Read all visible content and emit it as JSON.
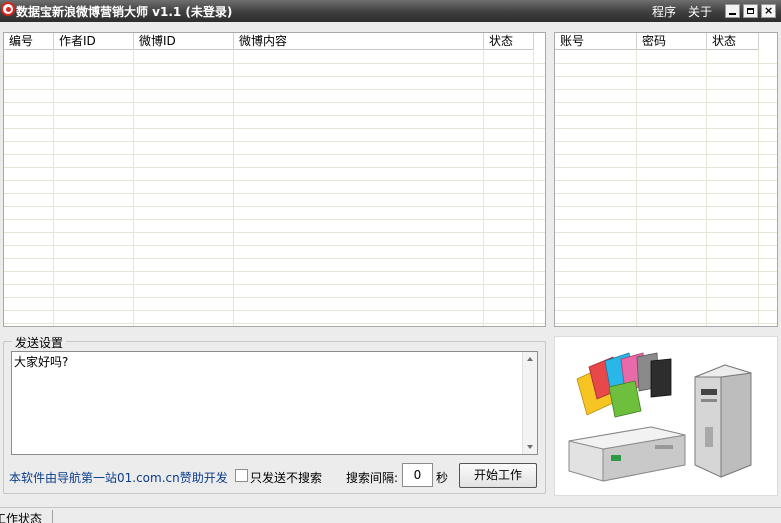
{
  "window": {
    "title": "数据宝新浪微博营销大师 v1.1 (未登录)",
    "menu": [
      "程序",
      "关于"
    ],
    "controls": {
      "minimize": "",
      "maximize": "",
      "close": "×"
    }
  },
  "posts_table": {
    "columns": [
      "编号",
      "作者ID",
      "微博ID",
      "微博内容",
      "状态"
    ],
    "rows": []
  },
  "accounts_table": {
    "columns": [
      "账号",
      "密码",
      "状态"
    ],
    "rows": []
  },
  "send_settings": {
    "legend": "发送设置",
    "message": "大家好吗?",
    "sponsor_text": "本软件由导航第一站01.com.cn赞助开发",
    "send_only_label": "只发送不搜索",
    "send_only_checked": false,
    "interval_label": "搜索间隔:",
    "interval_value": "0",
    "interval_unit": "秒",
    "start_button": "开始工作"
  },
  "status_bar": {
    "text": "工作状态"
  },
  "colors": {
    "title_bar": "#3f3f3f",
    "grid_line": "#e6e6d6",
    "link": "#0b3c8a"
  }
}
